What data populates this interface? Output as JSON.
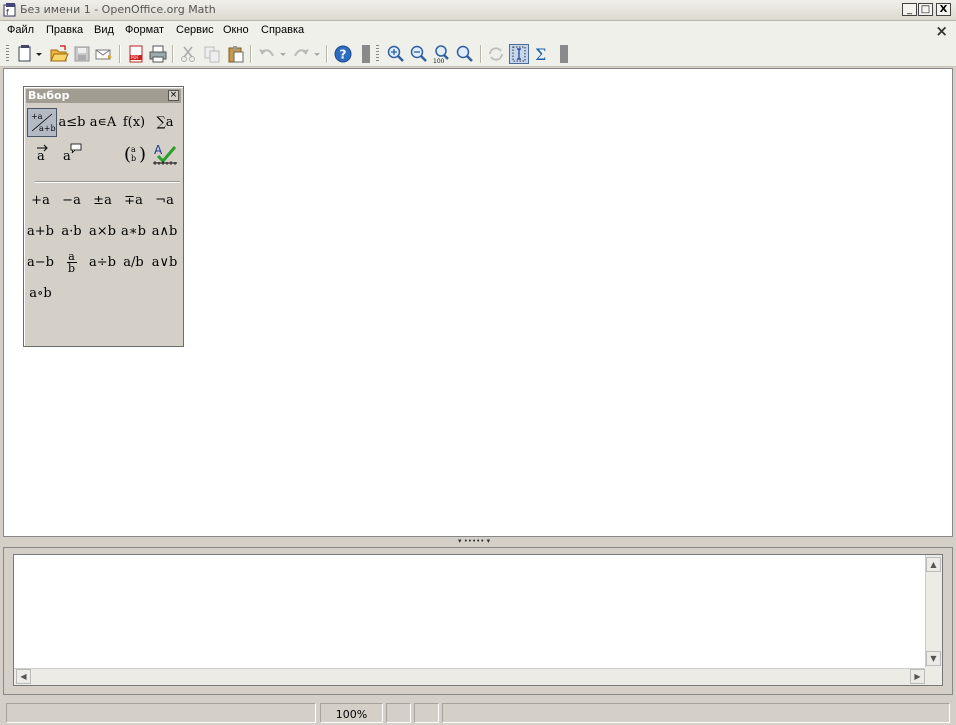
{
  "window": {
    "title": "Без имени 1 - OpenOffice.org Math",
    "minimize": "_",
    "maximize": "□",
    "close": "X"
  },
  "menu": {
    "items": [
      {
        "label": "Файл"
      },
      {
        "label": "Правка"
      },
      {
        "label": "Вид"
      },
      {
        "label": "Формат"
      },
      {
        "label": "Сервис"
      },
      {
        "label": "Окно"
      },
      {
        "label": "Справка"
      }
    ],
    "close_doc": "×"
  },
  "toolbar": {
    "buttons": [
      {
        "name": "new-document",
        "icon": "new-document-icon"
      },
      {
        "name": "open",
        "icon": "folder-open-icon"
      },
      {
        "name": "save",
        "icon": "save-icon"
      },
      {
        "name": "email",
        "icon": "email-icon"
      },
      {
        "name": "export-pdf",
        "icon": "pdf-icon"
      },
      {
        "name": "print",
        "icon": "printer-icon"
      },
      {
        "name": "cut",
        "icon": "scissors-icon"
      },
      {
        "name": "copy",
        "icon": "copy-icon"
      },
      {
        "name": "paste",
        "icon": "paste-icon"
      },
      {
        "name": "undo",
        "icon": "undo-icon"
      },
      {
        "name": "redo",
        "icon": "redo-icon"
      },
      {
        "name": "help",
        "icon": "help-icon"
      },
      {
        "name": "zoom-in",
        "icon": "zoom-in-icon"
      },
      {
        "name": "zoom-out",
        "icon": "zoom-out-icon"
      },
      {
        "name": "zoom-100",
        "icon": "zoom-100-icon"
      },
      {
        "name": "show-all",
        "icon": "zoom-fit-icon"
      },
      {
        "name": "update",
        "icon": "refresh-icon"
      },
      {
        "name": "selection",
        "icon": "formula-cursor-icon"
      },
      {
        "name": "elements",
        "icon": "sigma-icon"
      }
    ]
  },
  "palette": {
    "title": "Выбор",
    "close": "×",
    "categories": [
      {
        "label": "+a/a+b",
        "selected": true
      },
      {
        "label": "a≤b"
      },
      {
        "label": "a∊A"
      },
      {
        "label": "f(x)"
      },
      {
        "label": "∑a"
      },
      {
        "label": "a⃗"
      },
      {
        "label": "a💬"
      },
      {
        "label": "(a/b)"
      },
      {
        "label": "A✓"
      }
    ],
    "operators": [
      "+a",
      "−a",
      "±a",
      "∓a",
      "¬a",
      "a+b",
      "a·b",
      "a×b",
      "a∗b",
      "a∧b",
      "a−b",
      "a/b frac",
      "a÷b",
      "a/b",
      "a∨b",
      "a∘b"
    ],
    "fraction": {
      "num": "a",
      "den": "b"
    }
  },
  "command": {
    "text": ""
  },
  "statusbar": {
    "zoom": "100%"
  }
}
